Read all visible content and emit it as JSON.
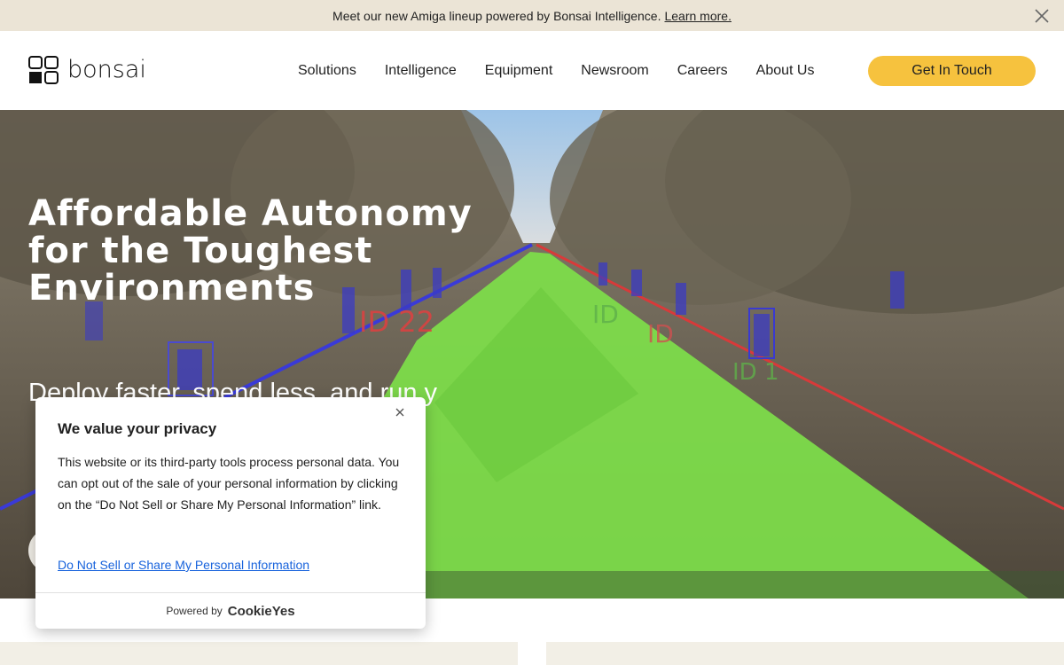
{
  "announcement": {
    "text": "Meet our new Amiga lineup powered by Bonsai Intelligence.",
    "link": "Learn more."
  },
  "header": {
    "logo_text": "bonsai",
    "nav": [
      "Solutions",
      "Intelligence",
      "Equipment",
      "Newsroom",
      "Careers",
      "About Us"
    ],
    "cta": "Get In Touch"
  },
  "hero": {
    "title": "Affordable Autonomy for the Toughest Environments",
    "subtitle": "Deploy faster, spend less, and run y",
    "overlay_labels": [
      "ID 22",
      "ID",
      "ID",
      "ID 1"
    ]
  },
  "cookie": {
    "title": "We value your privacy",
    "body": "This website or its third-party tools process personal data. You can opt out of the sale of your personal information by clicking on the “Do Not Sell or Share My Personal Information” link.",
    "optout_link": "Do Not Sell or Share My Personal Information",
    "powered_by": "Powered by",
    "powered_brand": "CookieYes"
  },
  "colors": {
    "announce_bg": "#ebe4d6",
    "cta_bg": "#f6c23e",
    "link_blue": "#1863dc",
    "segmentation_green": "#7ee04a"
  }
}
